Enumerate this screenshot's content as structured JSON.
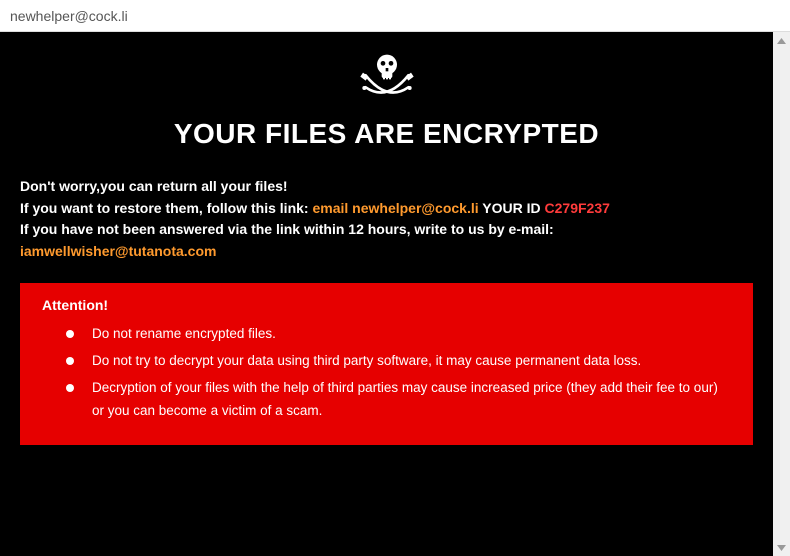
{
  "window": {
    "title": "newhelper@cock.li"
  },
  "ransom": {
    "heading": "YOUR FILES ARE ENCRYPTED",
    "line1": "Don't worry,you can return all your files!",
    "line2a": "If you want to restore them, follow this link: ",
    "line2_link": "email newhelper@cock.li",
    "line2b": "  YOUR ID ",
    "line2_id": "C279F237",
    "line3a": "If you have not been answered via the link within 12 hours, write to us by e-mail: ",
    "line3_email": "iamwellwisher@tutanota.com"
  },
  "attention": {
    "title": "Attention!",
    "items": [
      "Do not rename encrypted files.",
      "Do not try to decrypt your data using third party software, it may cause permanent data loss.",
      "Decryption of your files with the help of third parties may cause increased price (they add their fee to our) or you can become a victim of a scam."
    ]
  }
}
